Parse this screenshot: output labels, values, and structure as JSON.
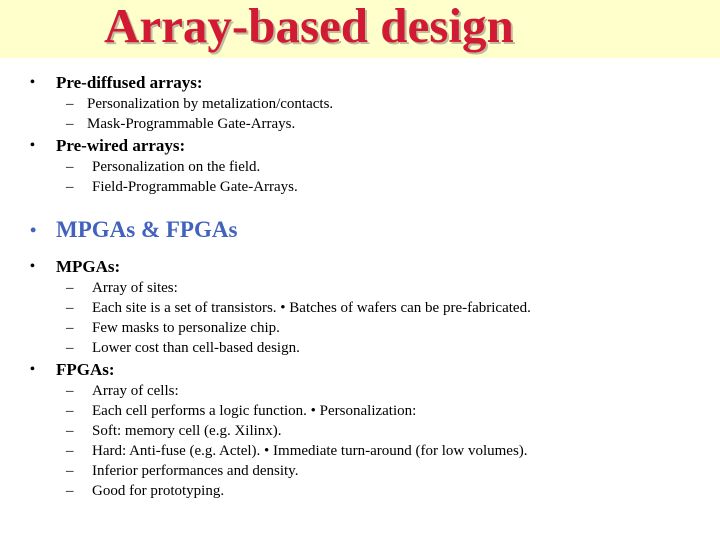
{
  "slide": {
    "title": "Array-based design",
    "title_color": "#d11a33",
    "banner_color": "#ffffcc",
    "accent_blue": "#4262bd",
    "body_color": "#000000",
    "bullet_marker": "•",
    "dash_marker": "–"
  },
  "body": {
    "blocks": [
      {
        "heading": "Pre-diffused arrays:",
        "items": [
          "Personalization by metalization/contacts.",
          "Mask-Programmable Gate-Arrays."
        ]
      },
      {
        "heading": "Pre-wired arrays:",
        "items": [
          "Personalization on the field.",
          "Field-Programmable Gate-Arrays."
        ]
      },
      {
        "heading": "MPGAs & FPGAs",
        "items": []
      },
      {
        "heading": "MPGAs:",
        "items": [
          "Array of sites:",
          "Each site is a set of transistors. • Batches of wafers can be pre-fabricated.",
          "Few masks to personalize chip.",
          "Lower cost than cell-based design."
        ]
      },
      {
        "heading": "FPGAs:",
        "items": [
          "Array of cells:",
          "Each cell performs a logic function. • Personalization:",
          "Soft: memory cell (e.g. Xilinx).",
          "Hard: Anti-fuse (e.g. Actel). • Immediate turn-around (for low volumes).",
          "Inferior performances and density.",
          "Good for prototyping."
        ]
      }
    ]
  }
}
